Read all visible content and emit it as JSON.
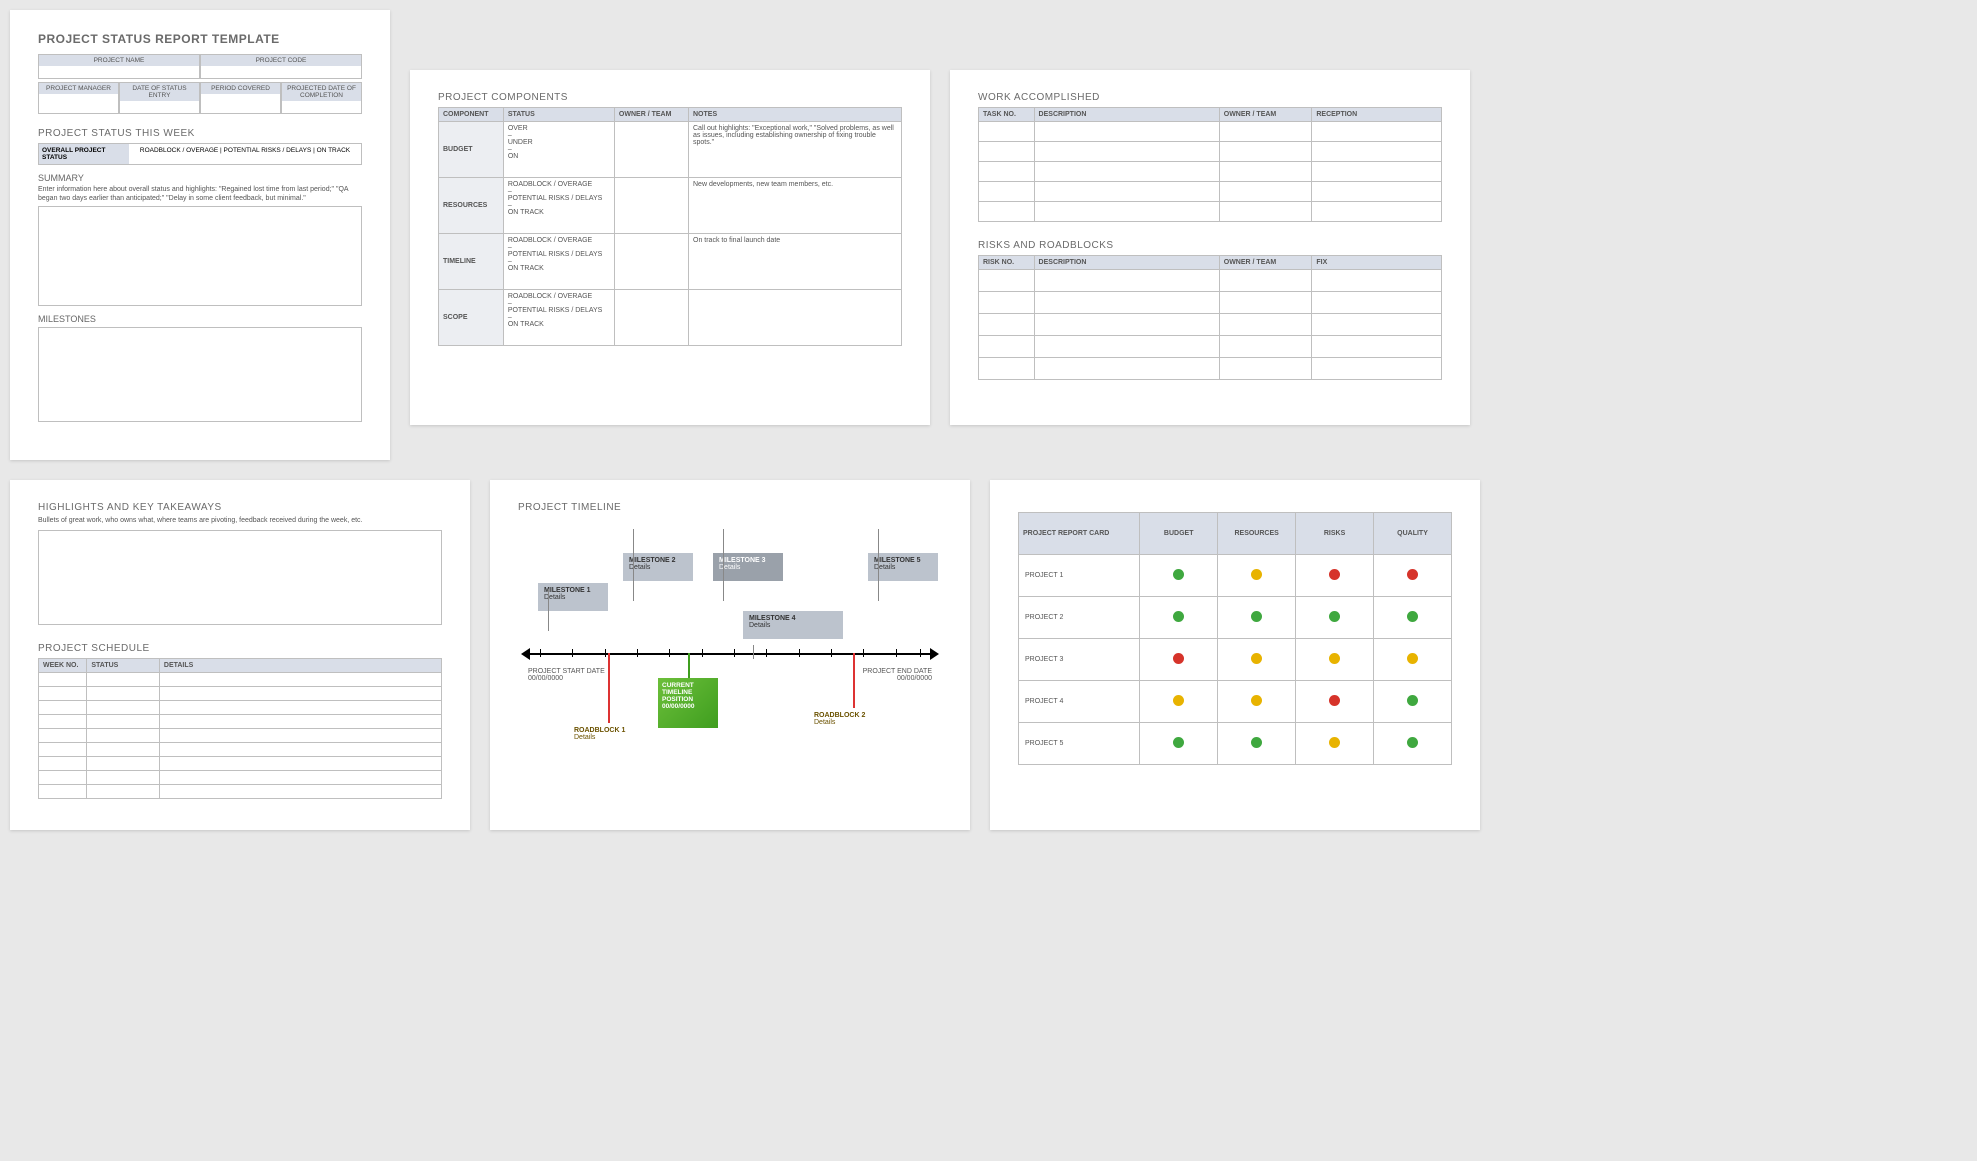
{
  "page1": {
    "title": "PROJECT STATUS REPORT TEMPLATE",
    "info1": {
      "name_lbl": "PROJECT NAME",
      "code_lbl": "PROJECT CODE"
    },
    "info2": {
      "pm": "PROJECT MANAGER",
      "date_entry": "DATE OF STATUS ENTRY",
      "period": "PERIOD COVERED",
      "projected": "PROJECTED DATE OF COMPLETION"
    },
    "status_week_title": "PROJECT STATUS THIS WEEK",
    "overall_lbl": "OVERALL PROJECT STATUS",
    "overall_opts": "ROADBLOCK / OVERAGE   |   POTENTIAL RISKS / DELAYS   |   ON TRACK",
    "summary_title": "SUMMARY",
    "summary_hint": "Enter information here about overall status and highlights: \"Regained lost time from last period;\" \"QA began two days earlier than anticipated;\" \"Delay in some client feedback, but minimal.\"",
    "milestones_title": "MILESTONES"
  },
  "page2": {
    "title": "PROJECT COMPONENTS",
    "cols": [
      "COMPONENT",
      "STATUS",
      "OWNER / TEAM",
      "NOTES"
    ],
    "rows": [
      {
        "label": "BUDGET",
        "status": "OVER\n–\nUNDER\n–\nON",
        "notes": "Call out highlights:  \"Exceptional work,\"  \"Solved problems, as well as issues, including establishing ownership of fixing trouble spots.\""
      },
      {
        "label": "RESOURCES",
        "status": "ROADBLOCK / OVERAGE\n–\nPOTENTIAL RISKS / DELAYS\n–\nON TRACK",
        "notes": "New developments, new team members, etc."
      },
      {
        "label": "TIMELINE",
        "status": "ROADBLOCK / OVERAGE\n–\nPOTENTIAL RISKS / DELAYS\n–\nON TRACK",
        "notes": "On track to final launch date"
      },
      {
        "label": "SCOPE",
        "status": "ROADBLOCK / OVERAGE\n–\nPOTENTIAL RISKS / DELAYS\n–\nON TRACK",
        "notes": ""
      }
    ]
  },
  "page3": {
    "work_title": "WORK ACCOMPLISHED",
    "work_cols": [
      "TASK NO.",
      "DESCRIPTION",
      "OWNER / TEAM",
      "RECEPTION"
    ],
    "risks_title": "RISKS AND ROADBLOCKS",
    "risks_cols": [
      "RISK NO.",
      "DESCRIPTION",
      "OWNER / TEAM",
      "FIX"
    ]
  },
  "page4": {
    "highlights_title": "HIGHLIGHTS AND KEY TAKEAWAYS",
    "highlights_hint": "Bullets of great work, who owns what, where teams are pivoting, feedback received during the week, etc.",
    "schedule_title": "PROJECT SCHEDULE",
    "schedule_cols": [
      "WEEK NO.",
      "STATUS",
      "DETAILS"
    ]
  },
  "page5": {
    "title": "PROJECT TIMELINE",
    "start_lbl": "PROJECT START DATE",
    "start_date": "00/00/0000",
    "end_lbl": "PROJECT END DATE",
    "end_date": "00/00/0000",
    "milestones": [
      {
        "name": "MILESTONE 1",
        "detail": "Details"
      },
      {
        "name": "MILESTONE 2",
        "detail": "Details"
      },
      {
        "name": "MILESTONE 3",
        "detail": "Details"
      },
      {
        "name": "MILESTONE 4",
        "detail": "Details"
      },
      {
        "name": "MILESTONE 5",
        "detail": "Details"
      }
    ],
    "current": {
      "line1": "CURRENT",
      "line2": "TIMELINE",
      "line3": "POSITION",
      "date": "00/00/0000"
    },
    "roadblocks": [
      {
        "name": "ROADBLOCK 1",
        "detail": "Details"
      },
      {
        "name": "ROADBLOCK 2",
        "detail": "Details"
      }
    ]
  },
  "page6": {
    "cols": [
      "PROJECT REPORT CARD",
      "BUDGET",
      "RESOURCES",
      "RISKS",
      "QUALITY"
    ],
    "rows": [
      {
        "name": "PROJECT 1",
        "cells": [
          "g",
          "y",
          "r",
          "r"
        ]
      },
      {
        "name": "PROJECT 2",
        "cells": [
          "g",
          "g",
          "g",
          "g"
        ]
      },
      {
        "name": "PROJECT 3",
        "cells": [
          "r",
          "y",
          "y",
          "y"
        ]
      },
      {
        "name": "PROJECT 4",
        "cells": [
          "y",
          "y",
          "r",
          "g"
        ]
      },
      {
        "name": "PROJECT 5",
        "cells": [
          "g",
          "g",
          "y",
          "g"
        ]
      }
    ]
  }
}
